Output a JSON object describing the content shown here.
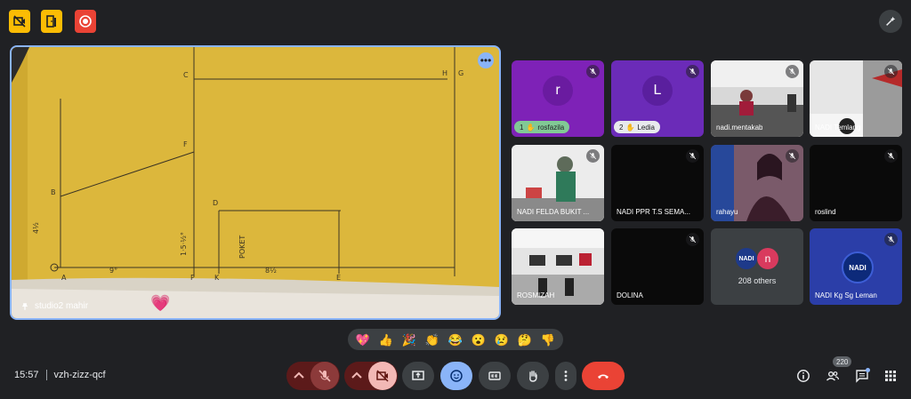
{
  "meeting": {
    "time": "15:57",
    "code": "vzh-zizz-qcf"
  },
  "main": {
    "presenter": "studio2 mahir"
  },
  "sketch_labels": [
    "C",
    "D",
    "B",
    "F",
    "A",
    "P",
    "K",
    "E",
    "H",
    "G",
    "4½",
    "9°",
    "8½",
    "1·5·½°",
    "POKET"
  ],
  "tiles": [
    {
      "name": "rosfazila",
      "initial": "r",
      "badge": "1",
      "color": "#7e22b7"
    },
    {
      "name": "Ledia",
      "initial": "L",
      "badge": "2",
      "color": "#6b2bb8"
    },
    {
      "name": "nadi.mentakab",
      "initial": ""
    },
    {
      "name": "NADI Temlang",
      "initial": ""
    },
    {
      "name": "NADI FELDA BUKIT ...",
      "initial": ""
    },
    {
      "name": "NADI PPR T.S SEMA...",
      "initial": ""
    },
    {
      "name": "rahayu",
      "initial": ""
    },
    {
      "name": "roslind",
      "initial": ""
    },
    {
      "name": "ROSMIZAH",
      "initial": ""
    },
    {
      "name": "DOLINA",
      "initial": ""
    },
    {
      "name": "208 others",
      "initial": "n",
      "logo": "NADI"
    },
    {
      "name": "NADI Kg Sg Leman",
      "logo": "NADI"
    }
  ],
  "reactions": [
    "💖",
    "👍",
    "🎉",
    "👏",
    "😂",
    "😮",
    "😢",
    "🤔",
    "👎"
  ],
  "participants_count": "220"
}
